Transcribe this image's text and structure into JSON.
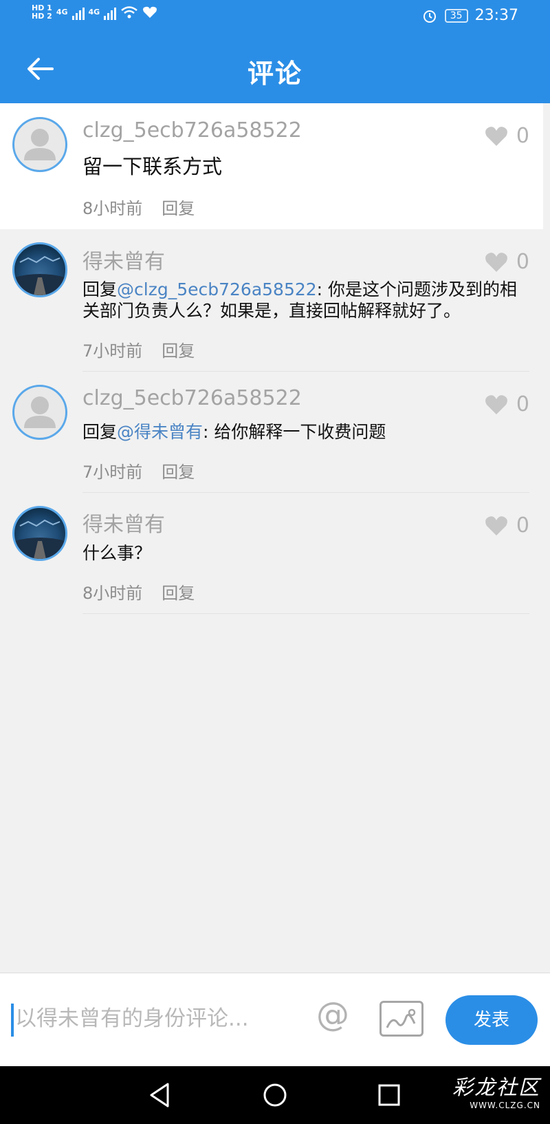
{
  "status_bar": {
    "hd1": "HD 1",
    "hd2": "HD 2",
    "net1": "4G",
    "net2": "4G",
    "battery": "35",
    "time": "23:37"
  },
  "header": {
    "title": "评论",
    "back_icon": "arrow-left-icon"
  },
  "colors": {
    "accent": "#2b8ee6",
    "mention": "#4a84c4",
    "username": "#a3a3a3"
  },
  "comments": [
    {
      "username": "clzg_5ecb726a58522",
      "avatar": "default-avatar",
      "text": "留一下联系方式",
      "mention": "",
      "time": "8小时前",
      "reply_label": "回复",
      "likes": "0"
    },
    {
      "username": "得未曾有",
      "avatar": "photo-avatar",
      "reply_prefix": "回复",
      "mention": "@clzg_5ecb726a58522",
      "text": ": 你是这个问题涉及到的相关部门负责人么？如果是，直接回帖解释就好了。",
      "time": "7小时前",
      "reply_label": "回复",
      "likes": "0"
    },
    {
      "username": "clzg_5ecb726a58522",
      "avatar": "default-avatar",
      "reply_prefix": "回复",
      "mention": "@得未曾有",
      "text": ": 给你解释一下收费问题",
      "time": "7小时前",
      "reply_label": "回复",
      "likes": "0"
    },
    {
      "username": "得未曾有",
      "avatar": "photo-avatar",
      "text": "什么事？",
      "mention": "",
      "time": "8小时前",
      "reply_label": "回复",
      "likes": "0"
    }
  ],
  "input_bar": {
    "placeholder": "以得未曾有的身份评论...",
    "at_symbol": "@",
    "send_label": "发表"
  },
  "watermark": {
    "main": "彩龙社区",
    "sub": "WWW.CLZG.CN"
  }
}
